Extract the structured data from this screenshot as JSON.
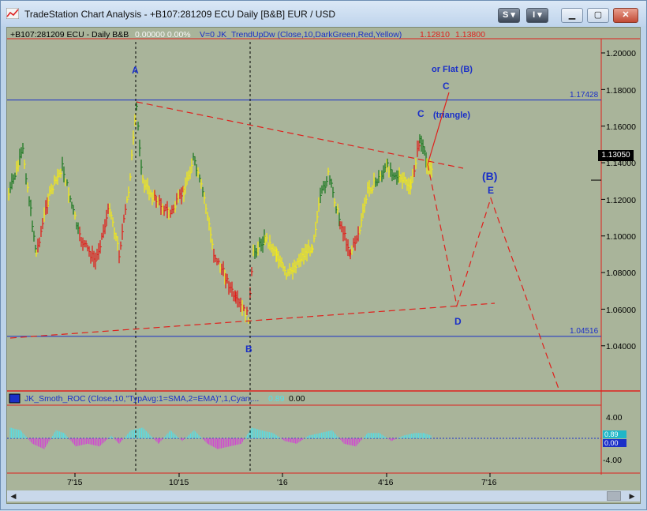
{
  "window": {
    "title": "TradeStation Chart Analysis - +B107:281209 ECU Daily [B&B] EUR / USD",
    "toolbar": {
      "s_label": "S ▾",
      "i_label": "I ▾"
    },
    "controls": {
      "minimize": "▁",
      "maximize": "▢",
      "close": "✕"
    }
  },
  "price_pane": {
    "header": {
      "symbol": "+B107:281209 ECU - Daily  B&B",
      "change": "0.00000  0.00%",
      "study": "V=0  JK_TrendUpDw  (Close,10,DarkGreen,Red,Yellow)",
      "value1": "1.12810",
      "value2": "1.13800"
    },
    "y_ticks": [
      "1.20000",
      "1.18000",
      "1.16000",
      "1.14000",
      "1.12000",
      "1.10000",
      "1.08000",
      "1.06000",
      "1.04000"
    ],
    "horizontal_levels": [
      {
        "label": "1.17428",
        "value": 1.17428
      },
      {
        "label": "1.04516",
        "value": 1.04516
      }
    ],
    "last_price": "1.13050",
    "wave_labels": {
      "a": "A",
      "b": "B",
      "c_actual": "C",
      "c_projected": "C",
      "d": "D",
      "e": "E",
      "big_b": "(B)"
    },
    "notes": {
      "or_flat": "or Flat (B)",
      "triangle": "(triangle)"
    }
  },
  "indicator_pane": {
    "header": {
      "study": "JK_Smoth_ROC (Close,10,\"TypAvg:1=SMA,2=EMA)\",1,Cyan,...",
      "value1": "0.89",
      "value2": "0.00"
    },
    "y_ticks": [
      "4.00",
      "-4.00"
    ],
    "last_values": [
      "0.89",
      "0.00"
    ]
  },
  "x_axis": {
    "ticks": [
      "7'15",
      "10'15",
      "'16",
      "4'16",
      "7'16"
    ]
  },
  "colors": {
    "chart_background": "#a9b49a",
    "up_bar": "#1f7a24",
    "down_bar": "#e0201c",
    "neutral_bar": "#f2e81a",
    "level_line": "#1a2fc8",
    "projection_line": "#e0201c",
    "roc_positive": "#4fe1ec",
    "roc_negative": "#d63ad6"
  },
  "chart_data": {
    "type": "line",
    "title": "",
    "xlabel": "",
    "ylabel": "",
    "ylim": [
      1.025,
      1.205
    ],
    "x": [
      "2015-05",
      "2015-06",
      "2015-07",
      "2015-08",
      "2015-09",
      "2015-10",
      "2015-11",
      "2015-12",
      "2016-01",
      "2016-02",
      "2016-03",
      "2016-04",
      "2016-05"
    ],
    "series": [
      {
        "values": [
          1.12,
          1.12,
          1.11,
          1.12,
          1.13,
          1.1,
          1.07,
          1.08,
          1.09,
          1.12,
          1.12,
          1.14,
          1.13
        ]
      }
    ]
  }
}
